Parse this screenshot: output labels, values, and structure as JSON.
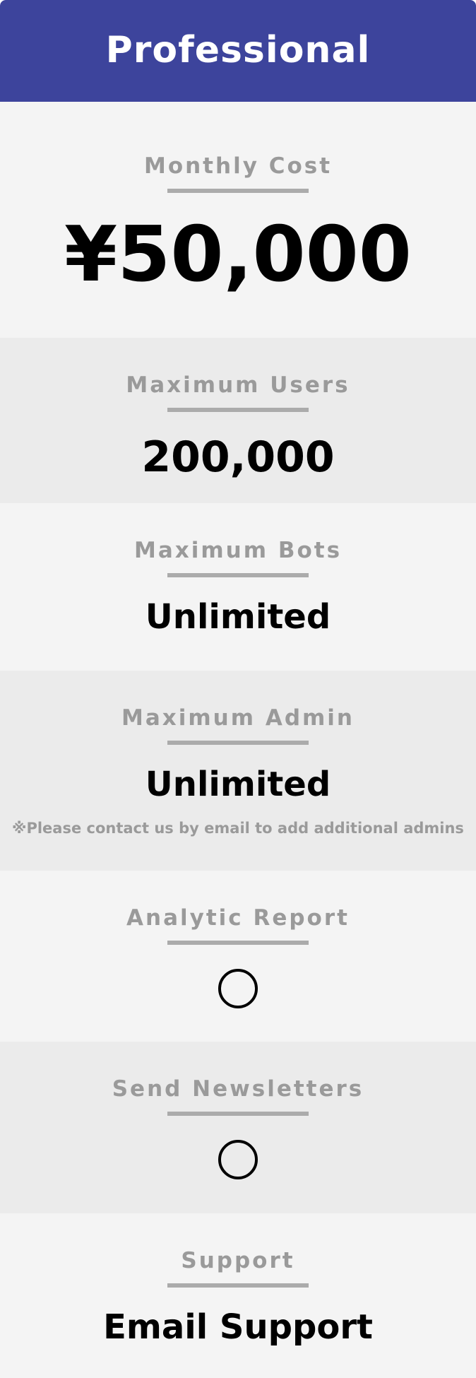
{
  "plan": {
    "title": "Professional",
    "accent_color": "#3d449c"
  },
  "features": {
    "monthly_cost": {
      "label": "Monthly Cost",
      "value": "¥50,000"
    },
    "max_users": {
      "label": "Maximum Users",
      "value": "200,000"
    },
    "max_bots": {
      "label": "Maximum Bots",
      "value": "Unlimited"
    },
    "max_admin": {
      "label": "Maximum Admin",
      "value": "Unlimited",
      "note": "※Please contact us by email to add additional admins"
    },
    "analytic_report": {
      "label": "Analytic Report",
      "value_icon": "circle-available-icon"
    },
    "send_newsletters": {
      "label": "Send Newsletters",
      "value_icon": "circle-available-icon"
    },
    "support": {
      "label": "Support",
      "value": "Email Support"
    }
  }
}
